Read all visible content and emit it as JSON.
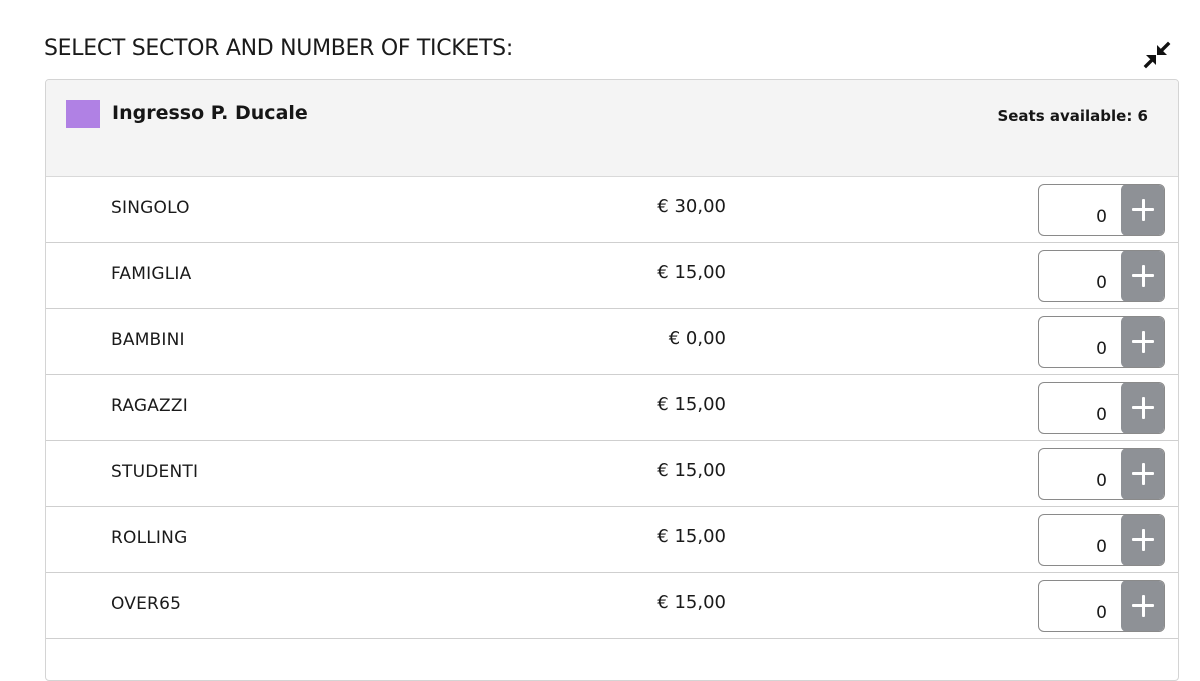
{
  "heading": "SELECT SECTOR AND NUMBER OF TICKETS:",
  "collapse_icon": "collapse-arrows-icon",
  "sector": {
    "name": "Ingresso P. Ducale",
    "seats_label": "Seats available: 6",
    "color": "#b081e4"
  },
  "tickets": [
    {
      "name": "SINGOLO",
      "price": "€ 30,00",
      "quantity": "0"
    },
    {
      "name": "FAMIGLIA",
      "price": "€ 15,00",
      "quantity": "0"
    },
    {
      "name": "BAMBINI",
      "price": "€ 0,00",
      "quantity": "0"
    },
    {
      "name": "RAGAZZI",
      "price": "€ 15,00",
      "quantity": "0"
    },
    {
      "name": "STUDENTI",
      "price": "€ 15,00",
      "quantity": "0"
    },
    {
      "name": "ROLLING",
      "price": "€ 15,00",
      "quantity": "0"
    },
    {
      "name": "OVER65",
      "price": "€ 15,00",
      "quantity": "0"
    }
  ],
  "plus_icon": "plus-icon",
  "colors": {
    "plus_button": "#8e9196",
    "header_bg": "#f4f4f4"
  }
}
